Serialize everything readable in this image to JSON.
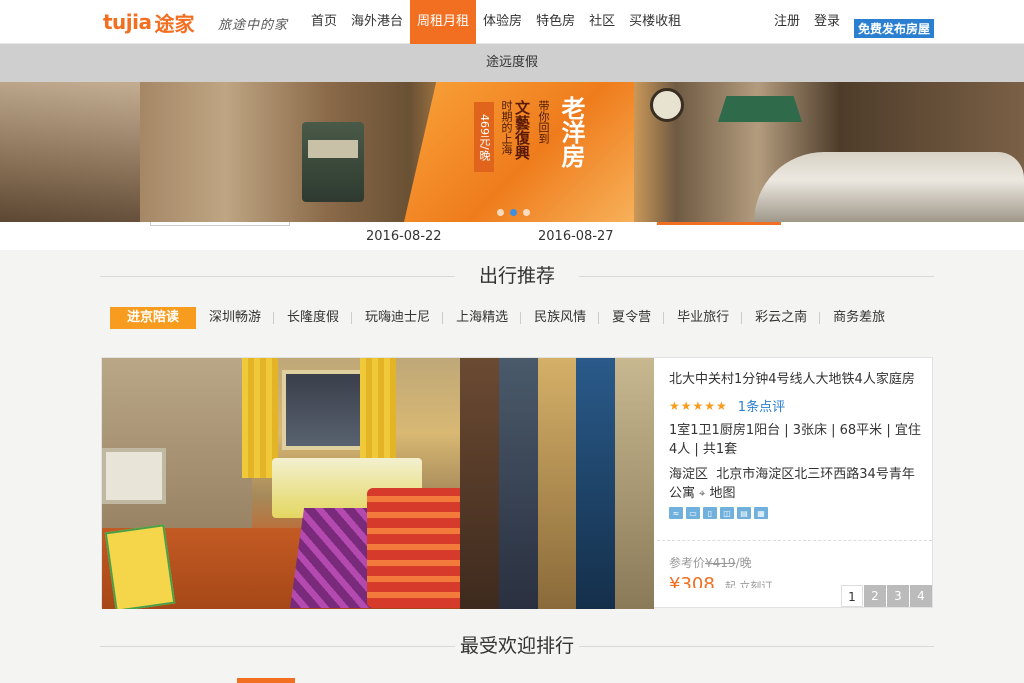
{
  "header": {
    "logo_en": "tujia",
    "logo_cn": "途家",
    "slogan": "旅途中的家",
    "nav": [
      {
        "label": "首页",
        "active": false
      },
      {
        "label": "海外港台",
        "active": false
      },
      {
        "label": "周租月租",
        "active": true
      },
      {
        "label": "体验房",
        "active": false
      },
      {
        "label": "特色房",
        "active": false
      },
      {
        "label": "社区",
        "active": false
      },
      {
        "label": "买楼收租",
        "active": false
      }
    ],
    "register": "注册",
    "login": "登录",
    "publish": "免费发布房屋"
  },
  "subbar": {
    "label": "途远度假"
  },
  "banner": {
    "price_tag": "469元/晚",
    "line1": "时期的上海",
    "line2": "文藝復興",
    "line3": "带你回到",
    "headline": "老洋房",
    "dots": 3,
    "active_dot": 1
  },
  "dates": [
    "2016-08-22",
    "2016-08-27"
  ],
  "recommend": {
    "title": "出行推荐",
    "tags": [
      {
        "label": "进京陪读",
        "active": true
      },
      {
        "label": "深圳畅游",
        "active": false
      },
      {
        "label": "长隆度假",
        "active": false
      },
      {
        "label": "玩嗨迪士尼",
        "active": false
      },
      {
        "label": "上海精选",
        "active": false
      },
      {
        "label": "民族风情",
        "active": false
      },
      {
        "label": "夏令营",
        "active": false
      },
      {
        "label": "毕业旅行",
        "active": false
      },
      {
        "label": "彩云之南",
        "active": false
      },
      {
        "label": "商务差旅",
        "active": false
      }
    ]
  },
  "listing": {
    "title": "北大中关村1分钟4号线人大地铁4人家庭房",
    "stars": "★★★★★",
    "rating": 5,
    "reviews": "1条点评",
    "specs": "1室1卫1厨房1阳台 | 3张床 | 68平米 | 宜住4人 | 共1套",
    "district": "海淀区",
    "address": "北京市海淀区北三环西路34号青年公寓",
    "map_icon": "location-pin-icon",
    "map_label": "地图",
    "amenities": [
      "wifi-icon",
      "tv-icon",
      "fridge-icon",
      "washer-icon",
      "kitchen-icon",
      "aircon-icon"
    ],
    "ref_price_label": "参考价",
    "ref_price": "¥419",
    "ref_price_unit": "/晚",
    "price": "¥308",
    "price_note": "起 立刻订",
    "pages": [
      "1",
      "2",
      "3",
      "4"
    ],
    "current_page": "1"
  },
  "ranking": {
    "title": "最受欢迎排行"
  },
  "colors": {
    "accent": "#f26f21",
    "tag_active": "#f79c1e",
    "link": "#2b7fd0"
  }
}
